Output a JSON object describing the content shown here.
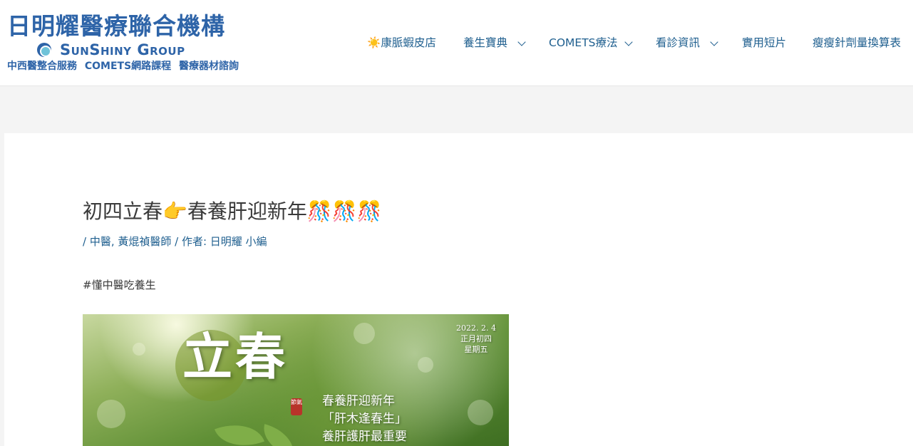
{
  "header": {
    "logo": {
      "cn_title": "日明耀醫療聯合機構",
      "en_name": "SunShiny Group",
      "subtitle": "中西醫整合服務 COMETS網路課程 醫療器材諮詢"
    },
    "nav": [
      {
        "icon": "☀️",
        "label": "康脈蝦皮店",
        "has_dropdown": false
      },
      {
        "label": "養生寶典",
        "has_dropdown": true
      },
      {
        "label": "COMETS療法",
        "has_dropdown": true
      },
      {
        "label": "看診資訊",
        "has_dropdown": true
      },
      {
        "label": "實用短片",
        "has_dropdown": false
      },
      {
        "label": "瘦瘦針劑量換算表",
        "has_dropdown": false
      }
    ]
  },
  "post": {
    "title": "初四立春👉春養肝迎新年🎊🎊🎊",
    "meta": "/ 中醫, 黃焜禎醫師 / 作者: 日明耀 小編",
    "tag": "#懂中醫吃養生"
  },
  "hero_image": {
    "big_text": "立春",
    "seal_text": "節氣",
    "date_lines": [
      "2022. 2. 4",
      "正月初四",
      "星期五"
    ],
    "poem_lines": [
      "春養肝迎新年",
      "「肝木逢春生」",
      "養肝護肝最重要"
    ]
  },
  "colors": {
    "brand_blue": "#2e64a8",
    "nav_link": "#1f5f8f",
    "page_bg": "#f4f4f4"
  }
}
